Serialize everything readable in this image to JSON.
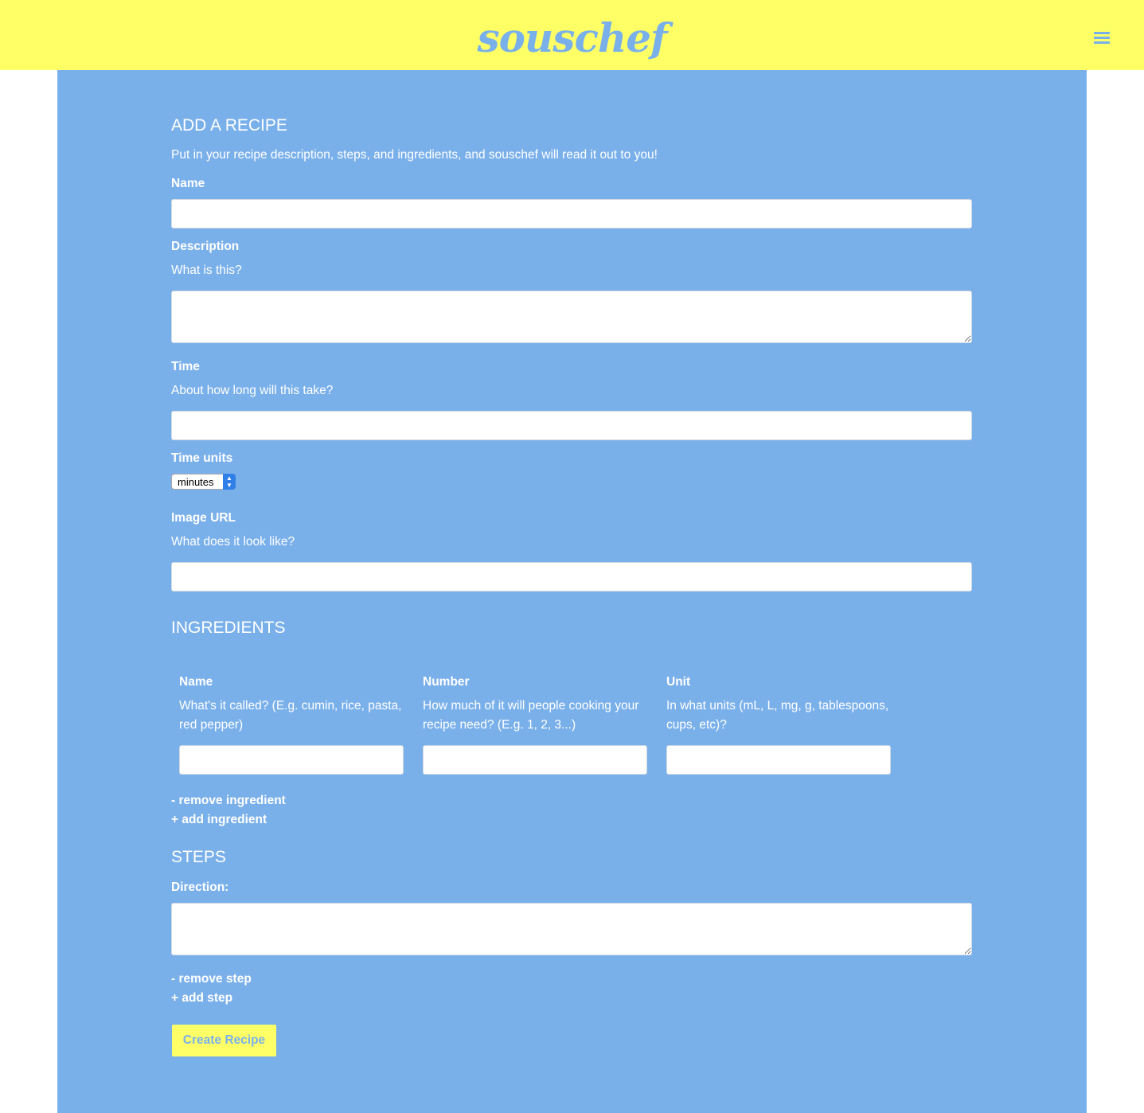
{
  "header": {
    "logo": "souschef",
    "menu_icon": "hamburger-menu-icon"
  },
  "form": {
    "title": "ADD A RECIPE",
    "intro": "Put in your recipe description, steps, and ingredients, and souschef will read it out to you!",
    "name": {
      "label": "Name",
      "value": ""
    },
    "description": {
      "label": "Description",
      "help": "What is this?",
      "value": ""
    },
    "time": {
      "label": "Time",
      "help": "About how long will this take?",
      "value": ""
    },
    "time_units": {
      "label": "Time units",
      "selected": "minutes"
    },
    "image_url": {
      "label": "Image URL",
      "help": "What does it look like?",
      "value": ""
    }
  },
  "ingredients": {
    "title": "INGREDIENTS",
    "columns": [
      {
        "label": "Name",
        "help": "What's it called? (E.g. cumin, rice, pasta, red pepper)",
        "value": ""
      },
      {
        "label": "Number",
        "help": "How much of it will people cooking your recipe need? (E.g. 1, 2, 3...)",
        "value": ""
      },
      {
        "label": "Unit",
        "help": "In what units (mL, L, mg, g, tablespoons, cups, etc)?",
        "value": ""
      }
    ],
    "remove_label": "- remove ingredient",
    "add_label": "+ add ingredient"
  },
  "steps": {
    "title": "STEPS",
    "direction_label": "Direction:",
    "direction_value": "",
    "remove_label": "- remove step",
    "add_label": "+ add step"
  },
  "submit_label": "Create Recipe",
  "colors": {
    "header_bg": "#ffff66",
    "main_bg": "#7ab0ea",
    "accent": "#7ab0ea",
    "button_bg": "#ffff66"
  }
}
